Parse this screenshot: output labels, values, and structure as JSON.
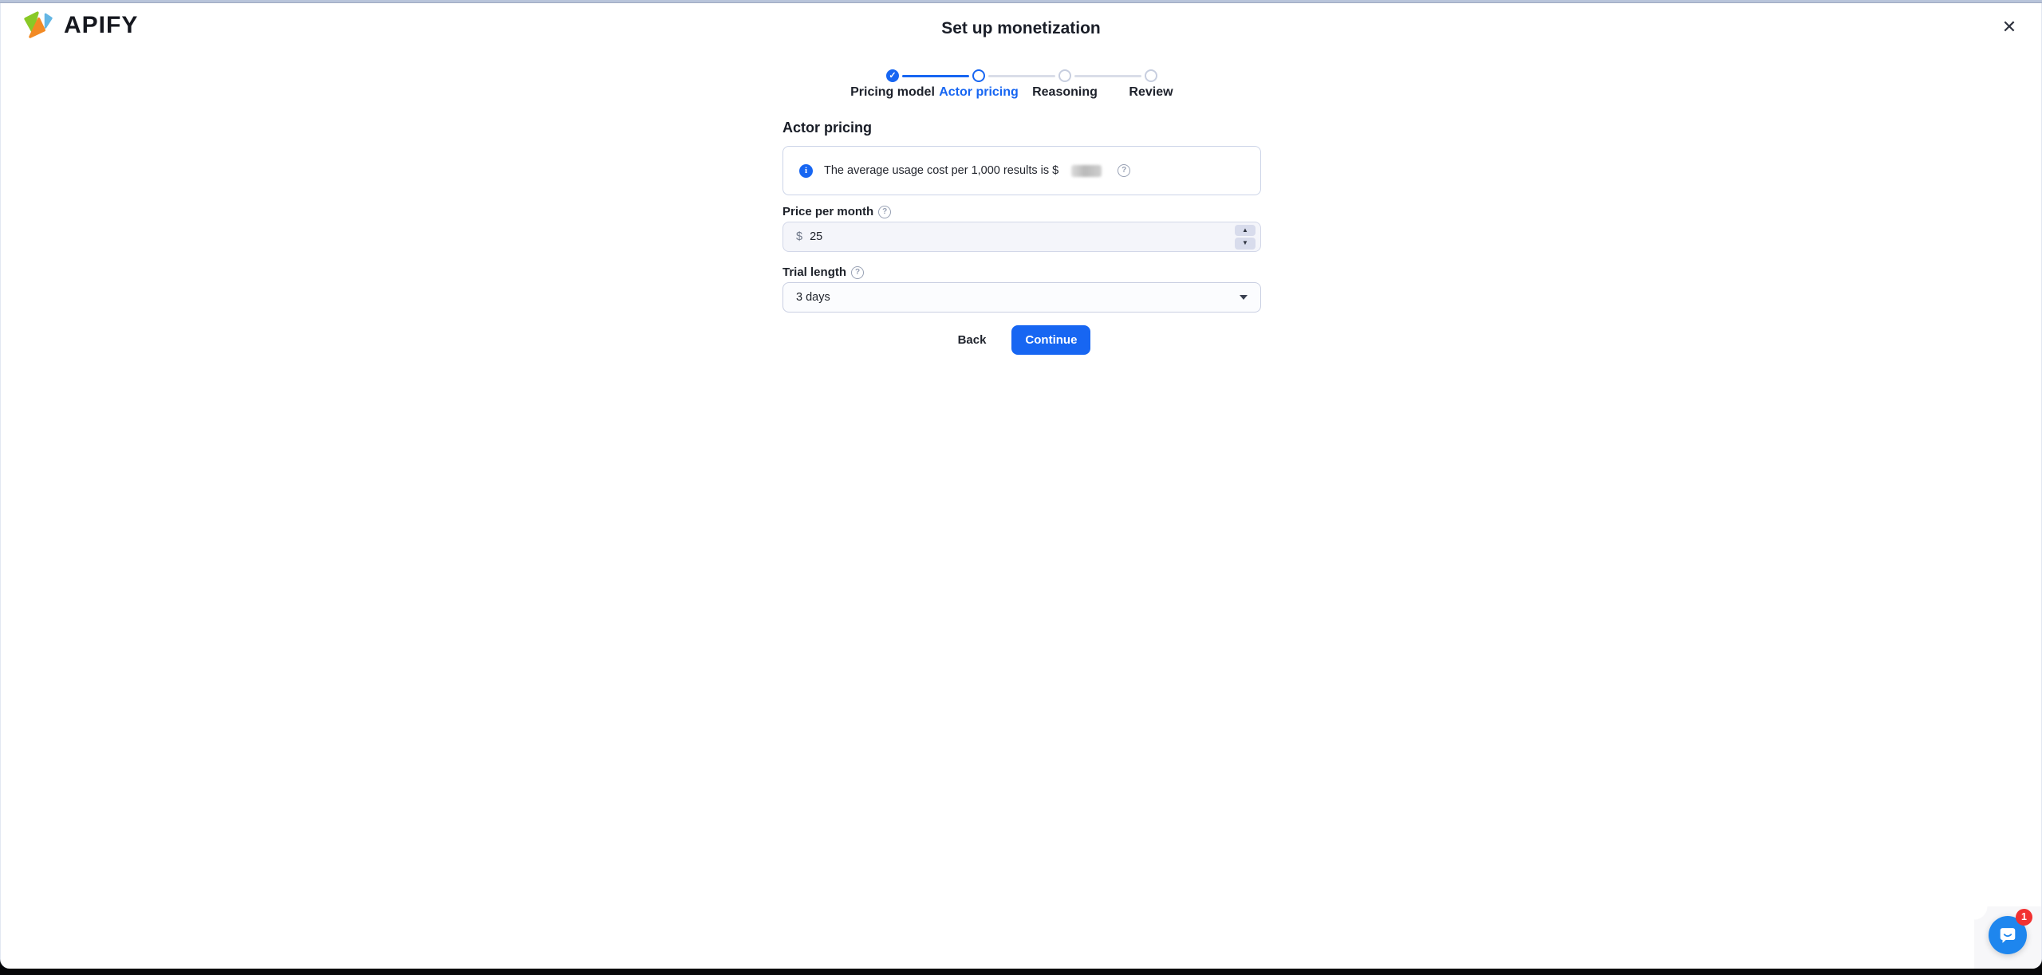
{
  "brand": {
    "name": "APIFY"
  },
  "modal": {
    "title": "Set up monetization",
    "close_glyph": "✕"
  },
  "stepper": {
    "steps": [
      {
        "label": "Pricing model",
        "state": "completed"
      },
      {
        "label": "Actor pricing",
        "state": "active"
      },
      {
        "label": "Reasoning",
        "state": "upcoming"
      },
      {
        "label": "Review",
        "state": "upcoming"
      }
    ],
    "check_glyph": "✓"
  },
  "content": {
    "heading": "Actor pricing",
    "info_banner": {
      "text": "The average usage cost per 1,000 results is $",
      "value_redacted": true,
      "help_glyph": "?"
    },
    "price_field": {
      "label": "Price per month",
      "currency_symbol": "$",
      "value": "25",
      "help_glyph": "?"
    },
    "trial_field": {
      "label": "Trial length",
      "selected_option": "3 days",
      "help_glyph": "?"
    },
    "back_label": "Back",
    "continue_label": "Continue"
  },
  "info_icon_glyph": "i",
  "chat": {
    "badge_count": "1"
  },
  "colors": {
    "accent_blue": "#1766f2",
    "chat_blue": "#1e86ee",
    "badge_red": "#f23131",
    "top_strip": "#b8c4da",
    "input_bg": "#f4f5fa",
    "border": "#d2d7e8"
  }
}
